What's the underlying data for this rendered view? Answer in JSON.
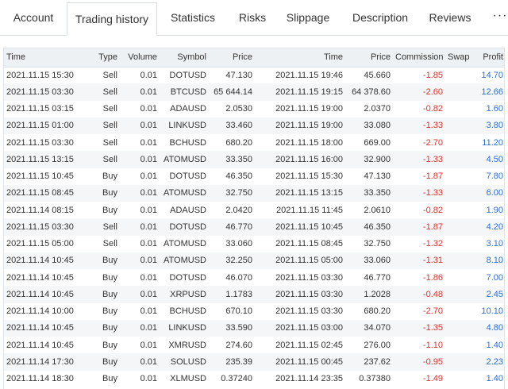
{
  "tabs": [
    "Account",
    "Trading history",
    "Statistics",
    "Risks",
    "Slippage",
    "Description",
    "Reviews"
  ],
  "more_label": "···",
  "columns": [
    "Time",
    "Type",
    "Volume",
    "Symbol",
    "Price",
    "Time",
    "Price",
    "Commission",
    "Swap",
    "Profit"
  ],
  "rows": [
    [
      "2021.11.15 15:30",
      "Sell",
      "0.01",
      "DOTUSD",
      "47.130",
      "2021.11.15 19:46",
      "45.660",
      "-1.85",
      "",
      "14.70"
    ],
    [
      "2021.11.15 03:30",
      "Sell",
      "0.01",
      "BTCUSD",
      "65 644.14",
      "2021.11.15 19:15",
      "64 378.60",
      "-2.60",
      "",
      "12.66"
    ],
    [
      "2021.11.15 03:15",
      "Sell",
      "0.01",
      "ADAUSD",
      "2.0530",
      "2021.11.15 19:00",
      "2.0370",
      "-0.82",
      "",
      "1.60"
    ],
    [
      "2021.11.15 01:00",
      "Sell",
      "0.01",
      "LINKUSD",
      "33.460",
      "2021.11.15 19:00",
      "33.080",
      "-1.33",
      "",
      "3.80"
    ],
    [
      "2021.11.15 03:30",
      "Sell",
      "0.01",
      "BCHUSD",
      "680.20",
      "2021.11.15 18:00",
      "669.00",
      "-2.70",
      "",
      "11.20"
    ],
    [
      "2021.11.15 13:15",
      "Sell",
      "0.01",
      "ATOMUSD",
      "33.350",
      "2021.11.15 16:00",
      "32.900",
      "-1.33",
      "",
      "4.50"
    ],
    [
      "2021.11.15 10:45",
      "Buy",
      "0.01",
      "DOTUSD",
      "46.350",
      "2021.11.15 15:30",
      "47.130",
      "-1.87",
      "",
      "7.80"
    ],
    [
      "2021.11.15 08:45",
      "Buy",
      "0.01",
      "ATOMUSD",
      "32.750",
      "2021.11.15 13:15",
      "33.350",
      "-1.33",
      "",
      "6.00"
    ],
    [
      "2021.11.14 08:15",
      "Buy",
      "0.01",
      "ADAUSD",
      "2.0420",
      "2021.11.15 11:45",
      "2.0610",
      "-0.82",
      "",
      "1.90"
    ],
    [
      "2021.11.15 03:30",
      "Sell",
      "0.01",
      "DOTUSD",
      "46.770",
      "2021.11.15 10:45",
      "46.350",
      "-1.87",
      "",
      "4.20"
    ],
    [
      "2021.11.15 05:00",
      "Sell",
      "0.01",
      "ATOMUSD",
      "33.060",
      "2021.11.15 08:45",
      "32.750",
      "-1.32",
      "",
      "3.10"
    ],
    [
      "2021.11.14 10:45",
      "Buy",
      "0.01",
      "ATOMUSD",
      "32.250",
      "2021.11.15 05:00",
      "33.060",
      "-1.31",
      "",
      "8.10"
    ],
    [
      "2021.11.14 10:45",
      "Buy",
      "0.01",
      "DOTUSD",
      "46.070",
      "2021.11.15 03:30",
      "46.770",
      "-1.86",
      "",
      "7.00"
    ],
    [
      "2021.11.14 10:45",
      "Buy",
      "0.01",
      "XRPUSD",
      "1.1783",
      "2021.11.15 03:30",
      "1.2028",
      "-0.48",
      "",
      "2.45"
    ],
    [
      "2021.11.14 10:00",
      "Buy",
      "0.01",
      "BCHUSD",
      "670.10",
      "2021.11.15 03:30",
      "680.20",
      "-2.70",
      "",
      "10.10"
    ],
    [
      "2021.11.14 10:45",
      "Buy",
      "0.01",
      "LINKUSD",
      "33.590",
      "2021.11.15 03:00",
      "34.070",
      "-1.35",
      "",
      "4.80"
    ],
    [
      "2021.11.14 10:45",
      "Buy",
      "0.01",
      "XMRUSD",
      "274.60",
      "2021.11.15 02:45",
      "276.00",
      "-1.10",
      "",
      "1.40"
    ],
    [
      "2021.11.14 17:30",
      "Buy",
      "0.01",
      "SOLUSD",
      "235.39",
      "2021.11.15 00:45",
      "237.62",
      "-0.95",
      "",
      "2.23"
    ],
    [
      "2021.11.14 18:30",
      "Buy",
      "0.01",
      "XLMUSD",
      "0.37240",
      "2021.11.14 23:35",
      "0.37380",
      "-1.49",
      "",
      "1.40"
    ]
  ],
  "colors": {
    "negative": "#e0312b",
    "positive": "#2a6fd6"
  }
}
